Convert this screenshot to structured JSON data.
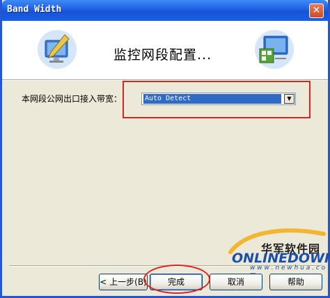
{
  "window": {
    "title": "Band Width",
    "close_symbol": "✕"
  },
  "header": {
    "title": "监控网段配置...",
    "left_icon": "monitor-pencil-icon",
    "right_icon": "network-monitor-icon"
  },
  "form": {
    "bandwidth_label": "本网段公网出口接入带宽：",
    "bandwidth_value": "Auto Detect",
    "dropdown_arrow": "▼"
  },
  "buttons": {
    "back_label": "< 上一步(B)",
    "finish_label": "完成",
    "cancel_label": "取消",
    "help_label": "帮助"
  },
  "watermark": {
    "chinese": "华军软件园",
    "brand": "ONLINEDOWN",
    "url": "w w w . n e w h u a . c o m"
  },
  "colors": {
    "titlebar": "#1d5fe3",
    "annotation": "#e2211c",
    "selection": "#316ac5"
  }
}
